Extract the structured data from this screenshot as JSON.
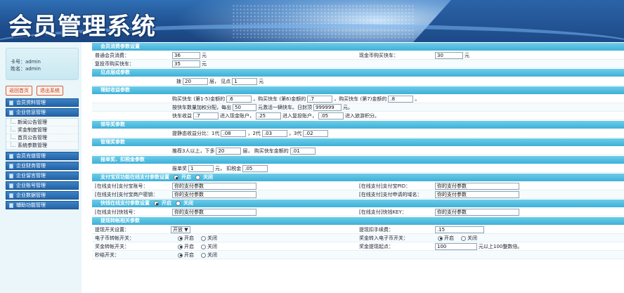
{
  "header": {
    "title": "会员管理系统"
  },
  "sidebar": {
    "user": {
      "card_label": "卡号：admin",
      "name_label": "姓名：admin"
    },
    "buttons": {
      "home": "返回首页",
      "logout": "退出系统"
    },
    "menu": [
      {
        "label": "会员资料管理"
      },
      {
        "label": "企业信息管理"
      }
    ],
    "submenu": [
      {
        "label": "新闻公告管理"
      },
      {
        "label": "奖金制度管理"
      },
      {
        "label": "首页公告管理"
      },
      {
        "label": "系统参数管理"
      }
    ],
    "menu2": [
      {
        "label": "会员充值管理"
      },
      {
        "label": "企业财务管理"
      },
      {
        "label": "企业留言管理"
      },
      {
        "label": "企业账号管理"
      },
      {
        "label": "企业数据管理"
      },
      {
        "label": "辅助功能管理"
      }
    ]
  },
  "sections": {
    "s1": "会员消费参数设置",
    "s2": "见点层成参数",
    "s3": "理财收益参数",
    "s4": "领导奖参数",
    "s5": "管理奖参数",
    "s6": "报单奖、扣税金参数",
    "s7": "支付宝双功能在线支付参数设置",
    "s8": "快钱在线支付参数设置",
    "s9": "提现转帐相关参数"
  },
  "s1": {
    "normal_label": "普通会员消费：",
    "normal_value": "36",
    "normal_unit": "元",
    "cash_label": "现金币购买快车：",
    "cash_value": "30",
    "cash_unit": "元",
    "repeat_label": "复投币购买快车：",
    "repeat_value": "35",
    "repeat_unit": "元"
  },
  "s2": {
    "t1": "拨",
    "v1": "20",
    "t2": "层， 见点",
    "v2": "1",
    "t3": "元"
  },
  "s3": {
    "r1a": "购买快车 (第1-5)金额的",
    "r1v1": ".6",
    "r1b": "，购买快车 (第6)金额的",
    "r1v2": ".7",
    "r1c": "，购买快车 (第7)金额的",
    "r1v3": ".8",
    "r1d": "。",
    "r2a": "按快车数量加权分配，每出",
    "r2v1": "50",
    "r2b": "元激活一辆快车。日封顶",
    "r2v2": "999999",
    "r2c": "元。",
    "r3a": "快车收益",
    "r3v1": ".7",
    "r3b": "进入现金账户，",
    "r3v2": ".25",
    "r3c": "进入复投账户，",
    "r3v3": ".05",
    "r3d": "进入旅游积分。"
  },
  "s4": {
    "a": "提静态收益分比：1代",
    "v1": ".08",
    "b": "，2代",
    "v2": ".03",
    "c": "，3代",
    "v3": ".02"
  },
  "s5": {
    "a": "推荐3人以上，下多",
    "v1": "20",
    "b": "层， 购买快车金额的",
    "v2": ".01"
  },
  "s6": {
    "a": "报单奖",
    "v1": "1",
    "b": "元， 扣税金",
    "v2": ".05"
  },
  "s7": {
    "open": "开启",
    "close": "关闭",
    "l1": "[在线支付]支付宝账号：",
    "v1": "你的支付参数",
    "l2": "[在线支付]支付宝PID：",
    "v2": "你的支付参数",
    "l3": "[在线支付]支付宝商户密钥：",
    "v3": "你的支付参数",
    "l4": "[在线支付]支付申请的域名：",
    "v4": "你的支付参数"
  },
  "s8": {
    "open": "开启",
    "close": "关闭",
    "l1": "[在线支付]快钱号：",
    "v1": "你的支付参数",
    "l2": "[在线支付]快钱KEY：",
    "v2": "你的支付参数"
  },
  "s9": {
    "l1": "提现开关设置：",
    "select": "开放 ▼",
    "l2": "提现扣手续费：",
    "v2": ".15",
    "l3": "电子币转帐开关：",
    "open": "开启",
    "close": "关闭",
    "l4": "奖金转入电子币开关：",
    "l5": "奖金转帐开关：",
    "l6": "奖金提现起点：",
    "v6": "100",
    "u6": "元以上100整数倍。",
    "l7": "秒结开关："
  }
}
